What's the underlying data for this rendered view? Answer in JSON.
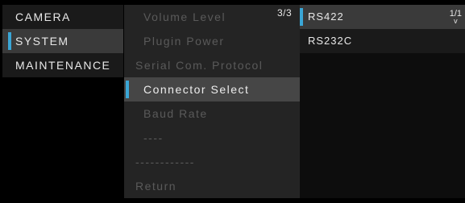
{
  "categories": [
    {
      "label": "CAMERA"
    },
    {
      "label": "SYSTEM"
    },
    {
      "label": "MAINTENANCE"
    }
  ],
  "submenu": {
    "page_indicator": "3/3",
    "items": [
      {
        "label": "Volume Level"
      },
      {
        "label": "Plugin Power"
      },
      {
        "label": "Serial Com. Protocol"
      },
      {
        "label": "Connector Select"
      },
      {
        "label": "Baud Rate"
      },
      {
        "label": "----"
      },
      {
        "label": "------------"
      },
      {
        "label": "Return"
      }
    ]
  },
  "options": {
    "page_indicator": "1/1",
    "items": [
      {
        "label": "RS422"
      },
      {
        "label": "RS232C"
      }
    ]
  },
  "colors": {
    "accent": "#3aa6d6",
    "background": "#000000",
    "submenu_panel": "#242424",
    "highlight": "#464646"
  }
}
